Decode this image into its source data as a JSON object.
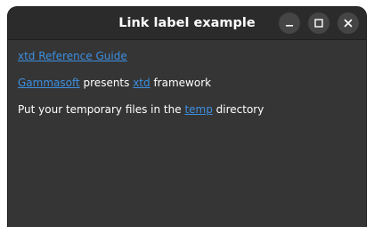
{
  "window": {
    "title": "Link label example"
  },
  "titlebar": {
    "minimize_icon": "minimize-icon",
    "maximize_icon": "maximize-icon",
    "close_icon": "close-icon"
  },
  "content": {
    "line1": {
      "link": "xtd Reference Guide"
    },
    "line2": {
      "link1": "Gammasoft",
      "text1": " presents ",
      "link2": "xtd",
      "text2": " framework"
    },
    "line3": {
      "text1": "Put your temporary files in the ",
      "link": "temp",
      "text2": " directory"
    }
  },
  "colors": {
    "window_bg": "#353535",
    "titlebar_bg": "#2b2b2b",
    "link": "#3d8fe0",
    "text": "#ffffff"
  }
}
